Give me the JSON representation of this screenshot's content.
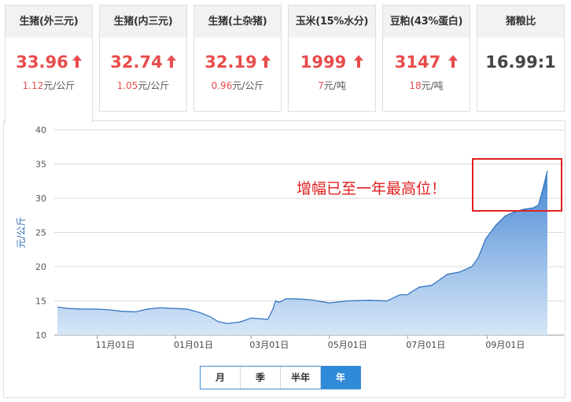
{
  "cards": [
    {
      "title": "生猪(外三元)",
      "price": "33.96",
      "change": "1.12",
      "unit": "元/公斤",
      "trend": "up"
    },
    {
      "title": "生猪(内三元)",
      "price": "32.74",
      "change": "1.05",
      "unit": "元/公斤",
      "trend": "up"
    },
    {
      "title": "生猪(土杂猪)",
      "price": "32.19",
      "change": "0.96",
      "unit": "元/公斤",
      "trend": "up"
    },
    {
      "title": "玉米(15%水分)",
      "price": "1999",
      "change": "7",
      "unit": "元/吨",
      "trend": "up"
    },
    {
      "title": "豆粕(43%蛋白)",
      "price": "3147",
      "change": "18",
      "unit": "元/吨",
      "trend": "up"
    },
    {
      "title": "猪粮比",
      "price": "16.99:1",
      "change": "",
      "unit": "",
      "trend": "none"
    }
  ],
  "colors": {
    "up": "#e84c4c",
    "accent": "#2f8ad8",
    "area": "#4a90d9"
  },
  "annotation": {
    "text": "增幅已至一年最高位！",
    "color": "#e02020"
  },
  "period_buttons": [
    {
      "label": "月",
      "active": false
    },
    {
      "label": "季",
      "active": false
    },
    {
      "label": "半年",
      "active": false
    },
    {
      "label": "年",
      "active": true
    }
  ],
  "chart_data": {
    "type": "area",
    "ylabel": "元/公斤",
    "ylim": [
      10,
      40
    ],
    "yticks": [
      10,
      15,
      20,
      25,
      30,
      35,
      40
    ],
    "x_tick_labels": [
      "11月01日",
      "01月01日",
      "03月01日",
      "05月01日",
      "07月01日",
      "09月01日"
    ],
    "x_tick_dates": [
      "2018-11-01",
      "2019-01-01",
      "2019-03-01",
      "2019-05-01",
      "2019-07-01",
      "2019-09-01"
    ],
    "x_range": [
      "2018-10-01",
      "2019-10-18"
    ],
    "grid": "horizontal",
    "series": [
      {
        "values": [
          [
            "2018-10-01",
            14.1
          ],
          [
            "2018-10-10",
            13.9
          ],
          [
            "2018-10-20",
            13.8
          ],
          [
            "2018-11-01",
            13.8
          ],
          [
            "2018-11-10",
            13.7
          ],
          [
            "2018-11-20",
            13.5
          ],
          [
            "2018-12-01",
            13.4
          ],
          [
            "2018-12-10",
            13.8
          ],
          [
            "2018-12-20",
            14.0
          ],
          [
            "2019-01-01",
            13.9
          ],
          [
            "2019-01-10",
            13.8
          ],
          [
            "2019-01-20",
            13.3
          ],
          [
            "2019-01-28",
            12.7
          ],
          [
            "2019-02-03",
            12.0
          ],
          [
            "2019-02-10",
            11.7
          ],
          [
            "2019-02-20",
            11.9
          ],
          [
            "2019-03-01",
            12.5
          ],
          [
            "2019-03-08",
            12.4
          ],
          [
            "2019-03-14",
            12.3
          ],
          [
            "2019-03-18",
            13.8
          ],
          [
            "2019-03-20",
            15.0
          ],
          [
            "2019-03-23",
            14.8
          ],
          [
            "2019-03-28",
            15.3
          ],
          [
            "2019-04-05",
            15.3
          ],
          [
            "2019-04-15",
            15.2
          ],
          [
            "2019-04-25",
            14.9
          ],
          [
            "2019-05-01",
            14.7
          ],
          [
            "2019-05-15",
            15.0
          ],
          [
            "2019-06-01",
            15.1
          ],
          [
            "2019-06-15",
            15.0
          ],
          [
            "2019-06-25",
            15.9
          ],
          [
            "2019-07-01",
            15.9
          ],
          [
            "2019-07-03",
            16.2
          ],
          [
            "2019-07-10",
            17.0
          ],
          [
            "2019-07-20",
            17.3
          ],
          [
            "2019-08-01",
            18.9
          ],
          [
            "2019-08-10",
            19.2
          ],
          [
            "2019-08-20",
            20.0
          ],
          [
            "2019-08-25",
            21.3
          ],
          [
            "2019-08-31",
            24.1
          ],
          [
            "2019-09-08",
            26.1
          ],
          [
            "2019-09-15",
            27.4
          ],
          [
            "2019-09-22",
            28.0
          ],
          [
            "2019-09-30",
            28.4
          ],
          [
            "2019-10-07",
            28.6
          ],
          [
            "2019-10-11",
            29.0
          ],
          [
            "2019-10-14",
            31.0
          ],
          [
            "2019-10-18",
            34.0
          ]
        ]
      }
    ]
  }
}
